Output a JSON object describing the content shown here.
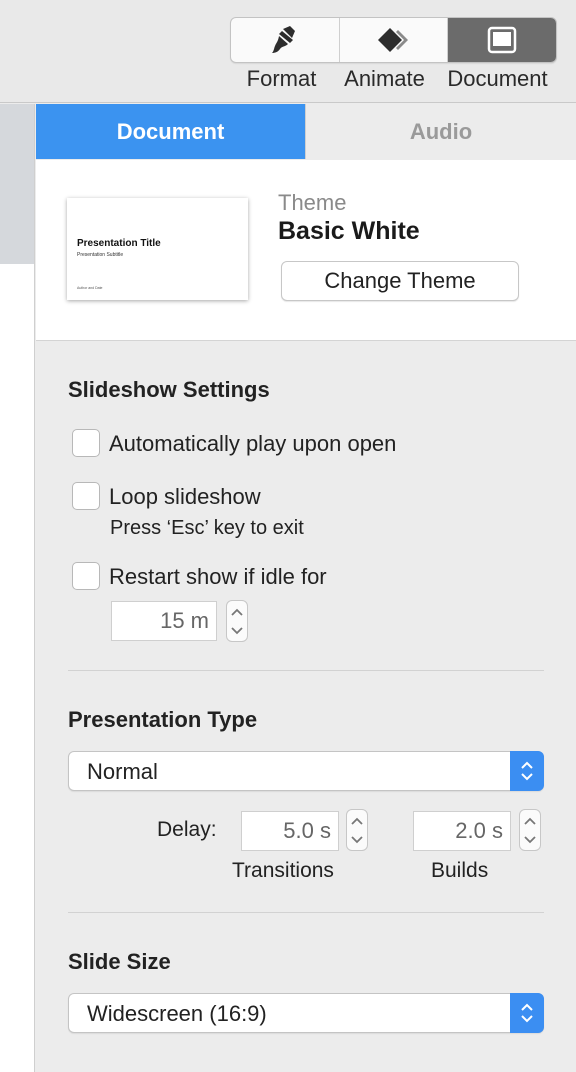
{
  "toolbar": {
    "buttons": [
      {
        "label": "Format",
        "icon": "paintbrush-icon"
      },
      {
        "label": "Animate",
        "icon": "diamond-arrows-icon"
      },
      {
        "label": "Document",
        "icon": "document-window-icon",
        "active": true
      }
    ]
  },
  "thumbnail": {
    "title": "Presentation Title",
    "subtitle": "Presentation Subtitle",
    "author": "Author and Date"
  },
  "tabs": {
    "document": "Document",
    "audio": "Audio"
  },
  "theme": {
    "label": "Theme",
    "name": "Basic White",
    "change_button": "Change Theme"
  },
  "slideshow": {
    "heading": "Slideshow Settings",
    "auto_play_label": "Automatically play upon open",
    "auto_play_checked": false,
    "loop_label": "Loop slideshow",
    "loop_checked": false,
    "loop_hint": "Press ‘Esc’ key to exit",
    "restart_label": "Restart show if idle for",
    "restart_checked": false,
    "idle_value": "15 m"
  },
  "presentation_type": {
    "heading": "Presentation Type",
    "selected": "Normal",
    "delay_label": "Delay:",
    "transitions_value": "5.0 s",
    "builds_value": "2.0 s",
    "transitions_label": "Transitions",
    "builds_label": "Builds"
  },
  "slide_size": {
    "heading": "Slide Size",
    "selected": "Widescreen (16:9)"
  },
  "colors": {
    "accent": "#3b93f0",
    "active_segment": "#6b6b6b"
  }
}
